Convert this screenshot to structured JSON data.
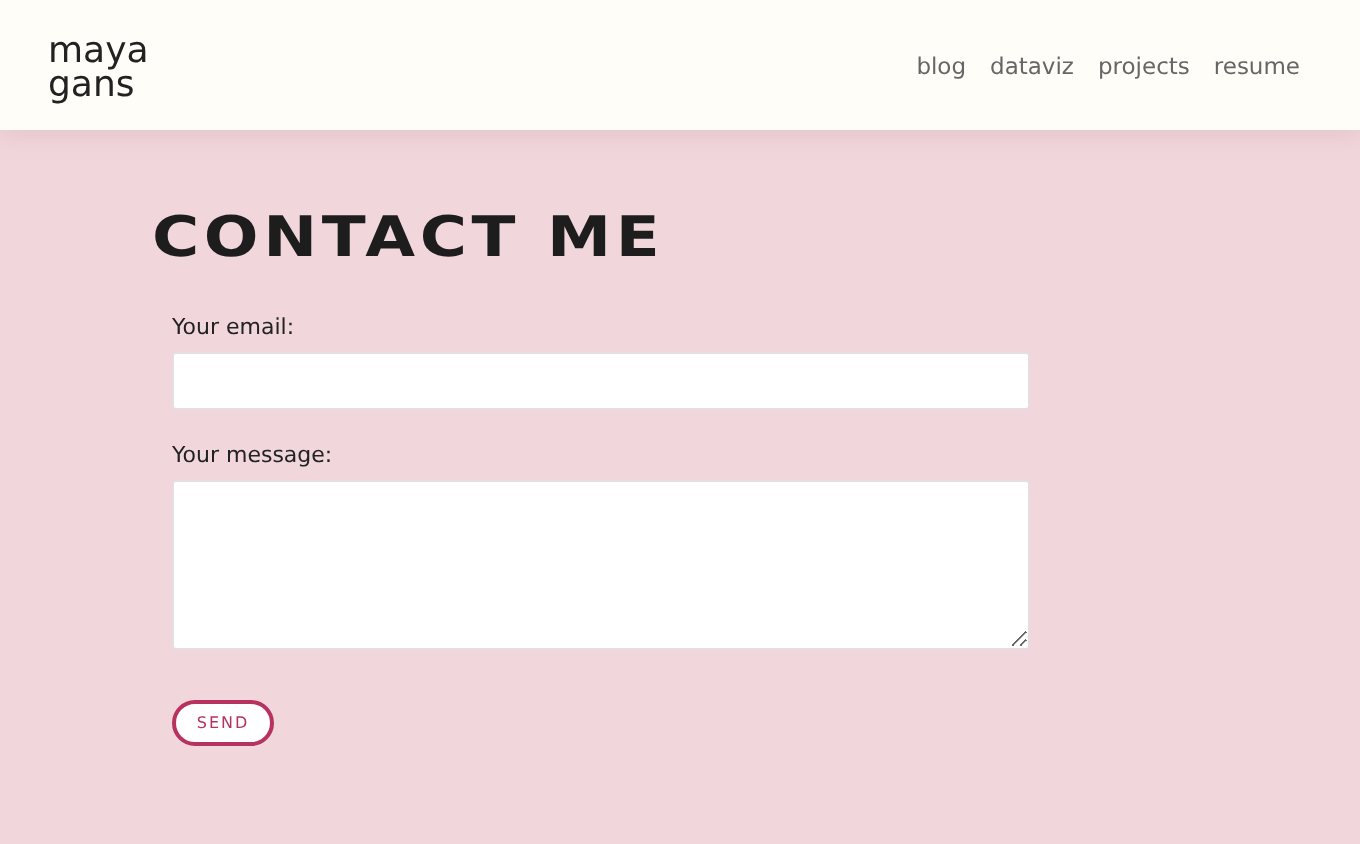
{
  "logo": {
    "lines": [
      "maya",
      "gans"
    ]
  },
  "nav": [
    {
      "label": "blog"
    },
    {
      "label": "dataviz"
    },
    {
      "label": "projects"
    },
    {
      "label": "resume"
    }
  ],
  "heading": "CONTACT ME",
  "form": {
    "fields": [
      {
        "kind": "input",
        "label": "Your email:"
      },
      {
        "kind": "textarea",
        "label": "Your message:"
      }
    ],
    "submit": "SEND"
  }
}
